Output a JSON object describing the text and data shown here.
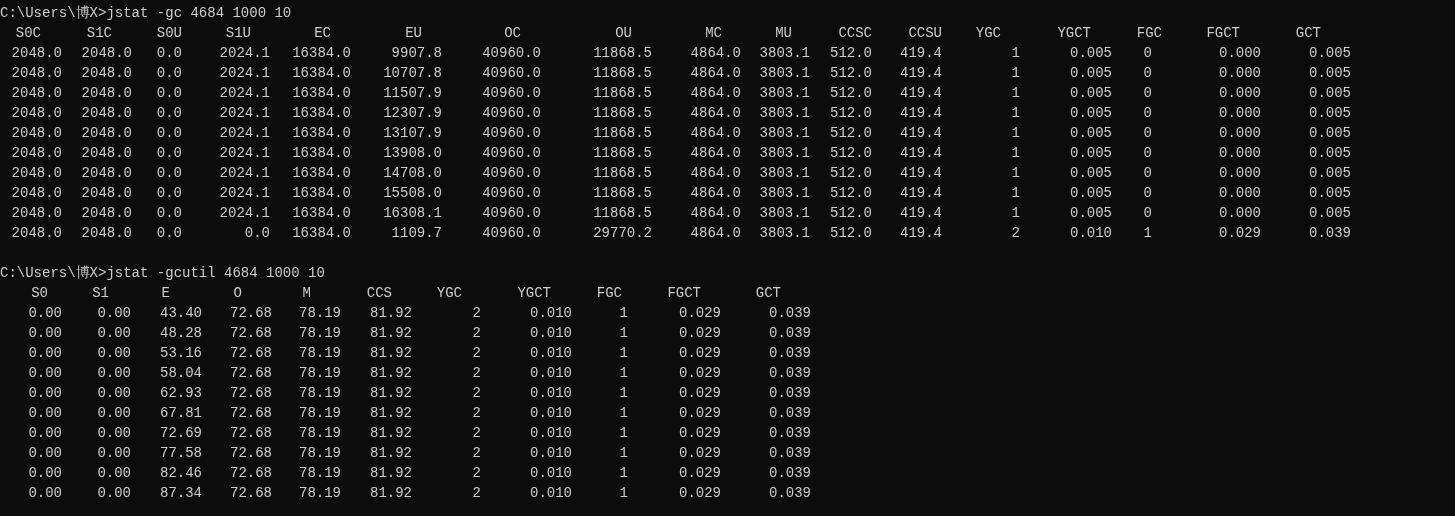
{
  "blocks": [
    {
      "command_line": "C:\\Users\\博X>jstat -gc 4684 1000 10",
      "columns": [
        "S0C",
        "S1C",
        "S0U",
        "S1U",
        "EC",
        "EU",
        "OC",
        "OU",
        "MC",
        "MU",
        "CCSC",
        "CCSU",
        "YGC",
        "YGCT",
        "FGC",
        "FGCT",
        "GCT"
      ],
      "rows": [
        [
          "2048.0",
          "2048.0",
          "0.0",
          "2024.1",
          "16384.0",
          "9907.8",
          "40960.0",
          "11868.5",
          "4864.0",
          "3803.1",
          "512.0",
          "419.4",
          "1",
          "0.005",
          "0",
          "0.000",
          "0.005"
        ],
        [
          "2048.0",
          "2048.0",
          "0.0",
          "2024.1",
          "16384.0",
          "10707.8",
          "40960.0",
          "11868.5",
          "4864.0",
          "3803.1",
          "512.0",
          "419.4",
          "1",
          "0.005",
          "0",
          "0.000",
          "0.005"
        ],
        [
          "2048.0",
          "2048.0",
          "0.0",
          "2024.1",
          "16384.0",
          "11507.9",
          "40960.0",
          "11868.5",
          "4864.0",
          "3803.1",
          "512.0",
          "419.4",
          "1",
          "0.005",
          "0",
          "0.000",
          "0.005"
        ],
        [
          "2048.0",
          "2048.0",
          "0.0",
          "2024.1",
          "16384.0",
          "12307.9",
          "40960.0",
          "11868.5",
          "4864.0",
          "3803.1",
          "512.0",
          "419.4",
          "1",
          "0.005",
          "0",
          "0.000",
          "0.005"
        ],
        [
          "2048.0",
          "2048.0",
          "0.0",
          "2024.1",
          "16384.0",
          "13107.9",
          "40960.0",
          "11868.5",
          "4864.0",
          "3803.1",
          "512.0",
          "419.4",
          "1",
          "0.005",
          "0",
          "0.000",
          "0.005"
        ],
        [
          "2048.0",
          "2048.0",
          "0.0",
          "2024.1",
          "16384.0",
          "13908.0",
          "40960.0",
          "11868.5",
          "4864.0",
          "3803.1",
          "512.0",
          "419.4",
          "1",
          "0.005",
          "0",
          "0.000",
          "0.005"
        ],
        [
          "2048.0",
          "2048.0",
          "0.0",
          "2024.1",
          "16384.0",
          "14708.0",
          "40960.0",
          "11868.5",
          "4864.0",
          "3803.1",
          "512.0",
          "419.4",
          "1",
          "0.005",
          "0",
          "0.000",
          "0.005"
        ],
        [
          "2048.0",
          "2048.0",
          "0.0",
          "2024.1",
          "16384.0",
          "15508.0",
          "40960.0",
          "11868.5",
          "4864.0",
          "3803.1",
          "512.0",
          "419.4",
          "1",
          "0.005",
          "0",
          "0.000",
          "0.005"
        ],
        [
          "2048.0",
          "2048.0",
          "0.0",
          "2024.1",
          "16384.0",
          "16308.1",
          "40960.0",
          "11868.5",
          "4864.0",
          "3803.1",
          "512.0",
          "419.4",
          "1",
          "0.005",
          "0",
          "0.000",
          "0.005"
        ],
        [
          "2048.0",
          "2048.0",
          "0.0",
          "0.0",
          "16384.0",
          "1109.7",
          "40960.0",
          "29770.2",
          "4864.0",
          "3803.1",
          "512.0",
          "419.4",
          "2",
          "0.010",
          "1",
          "0.029",
          "0.039"
        ]
      ]
    },
    {
      "command_line": "C:\\Users\\博X>jstat -gcutil 4684 1000 10",
      "columns": [
        "S0",
        "S1",
        "E",
        "O",
        "M",
        "CCS",
        "YGC",
        "YGCT",
        "FGC",
        "FGCT",
        "GCT"
      ],
      "rows": [
        [
          "0.00",
          "0.00",
          "43.40",
          "72.68",
          "78.19",
          "81.92",
          "2",
          "0.010",
          "1",
          "0.029",
          "0.039"
        ],
        [
          "0.00",
          "0.00",
          "48.28",
          "72.68",
          "78.19",
          "81.92",
          "2",
          "0.010",
          "1",
          "0.029",
          "0.039"
        ],
        [
          "0.00",
          "0.00",
          "53.16",
          "72.68",
          "78.19",
          "81.92",
          "2",
          "0.010",
          "1",
          "0.029",
          "0.039"
        ],
        [
          "0.00",
          "0.00",
          "58.04",
          "72.68",
          "78.19",
          "81.92",
          "2",
          "0.010",
          "1",
          "0.029",
          "0.039"
        ],
        [
          "0.00",
          "0.00",
          "62.93",
          "72.68",
          "78.19",
          "81.92",
          "2",
          "0.010",
          "1",
          "0.029",
          "0.039"
        ],
        [
          "0.00",
          "0.00",
          "67.81",
          "72.68",
          "78.19",
          "81.92",
          "2",
          "0.010",
          "1",
          "0.029",
          "0.039"
        ],
        [
          "0.00",
          "0.00",
          "72.69",
          "72.68",
          "78.19",
          "81.92",
          "2",
          "0.010",
          "1",
          "0.029",
          "0.039"
        ],
        [
          "0.00",
          "0.00",
          "77.58",
          "72.68",
          "78.19",
          "81.92",
          "2",
          "0.010",
          "1",
          "0.029",
          "0.039"
        ],
        [
          "0.00",
          "0.00",
          "82.46",
          "72.68",
          "78.19",
          "81.92",
          "2",
          "0.010",
          "1",
          "0.029",
          "0.039"
        ],
        [
          "0.00",
          "0.00",
          "87.34",
          "72.68",
          "78.19",
          "81.92",
          "2",
          "0.010",
          "1",
          "0.029",
          "0.039"
        ]
      ]
    }
  ]
}
